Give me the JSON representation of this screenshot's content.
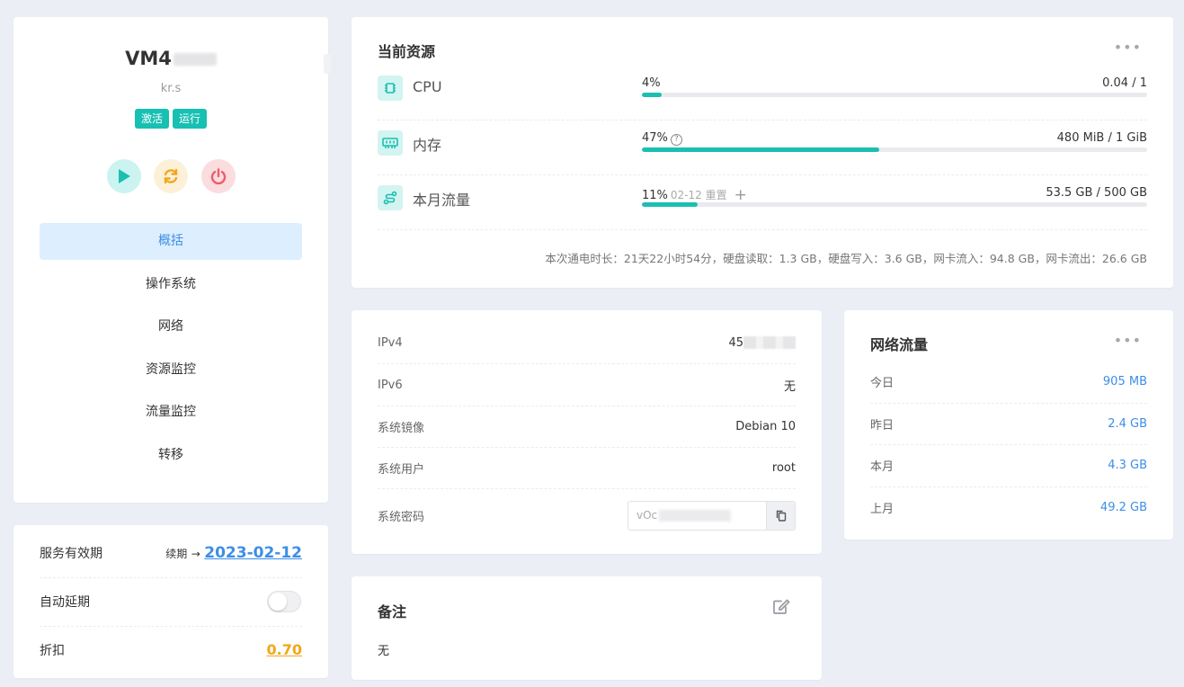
{
  "vm": {
    "name": "VM4",
    "host": "kr.s",
    "badges": [
      "激活",
      "运行"
    ]
  },
  "controls": {
    "icons": [
      "play-icon",
      "reload-icon",
      "power-icon"
    ],
    "colors": {
      "play": "#1bbfb2",
      "reload": "#f2a71a",
      "power": "#ef5b68"
    }
  },
  "menu": {
    "items": [
      "概括",
      "操作系统",
      "网络",
      "资源监控",
      "流量监控",
      "转移"
    ],
    "active_index": 0
  },
  "service": {
    "expiry_label": "服务有效期",
    "renew_label": "续期",
    "arrow": "→",
    "expiry_date": "2023-02-12",
    "auto_extend_label": "自动延期",
    "auto_extend_on": false,
    "discount_label": "折扣",
    "discount_value": "0.70"
  },
  "resources": {
    "title": "当前资源",
    "more": "•••",
    "cpu": {
      "label": "CPU",
      "percent_text": "4%",
      "percent": 4,
      "value": "0.04 / 1"
    },
    "memory": {
      "label": "内存",
      "percent_text": "47%",
      "percent": 47,
      "info": "?",
      "value": "480 MiB / 1 GiB"
    },
    "traffic": {
      "label": "本月流量",
      "percent_text": "11%",
      "percent": 11,
      "reset_note": "02-12 重置",
      "plus": "+",
      "value": "53.5 GB / 500 GB"
    },
    "summary": "本次通电时长：21天22小时54分，硬盘读取：1.3 GB，硬盘写入：3.6 GB，网卡流入：94.8 GB，网卡流出：26.6 GB"
  },
  "network": {
    "ipv4_label": "IPv4",
    "ipv4_value": "45",
    "ipv6_label": "IPv6",
    "ipv6_value": "无",
    "image_label": "系统镜像",
    "image_value": "Debian 10",
    "user_label": "系统用户",
    "user_value": "root",
    "password_label": "系统密码",
    "password_value": "vOc"
  },
  "traffic_card": {
    "title": "网络流量",
    "more": "•••",
    "rows": [
      {
        "label": "今日",
        "value": "905 MB"
      },
      {
        "label": "昨日",
        "value": "2.4 GB"
      },
      {
        "label": "本月",
        "value": "4.3 GB"
      },
      {
        "label": "上月",
        "value": "49.2 GB"
      }
    ]
  },
  "notes": {
    "title": "备注",
    "text": "无"
  }
}
